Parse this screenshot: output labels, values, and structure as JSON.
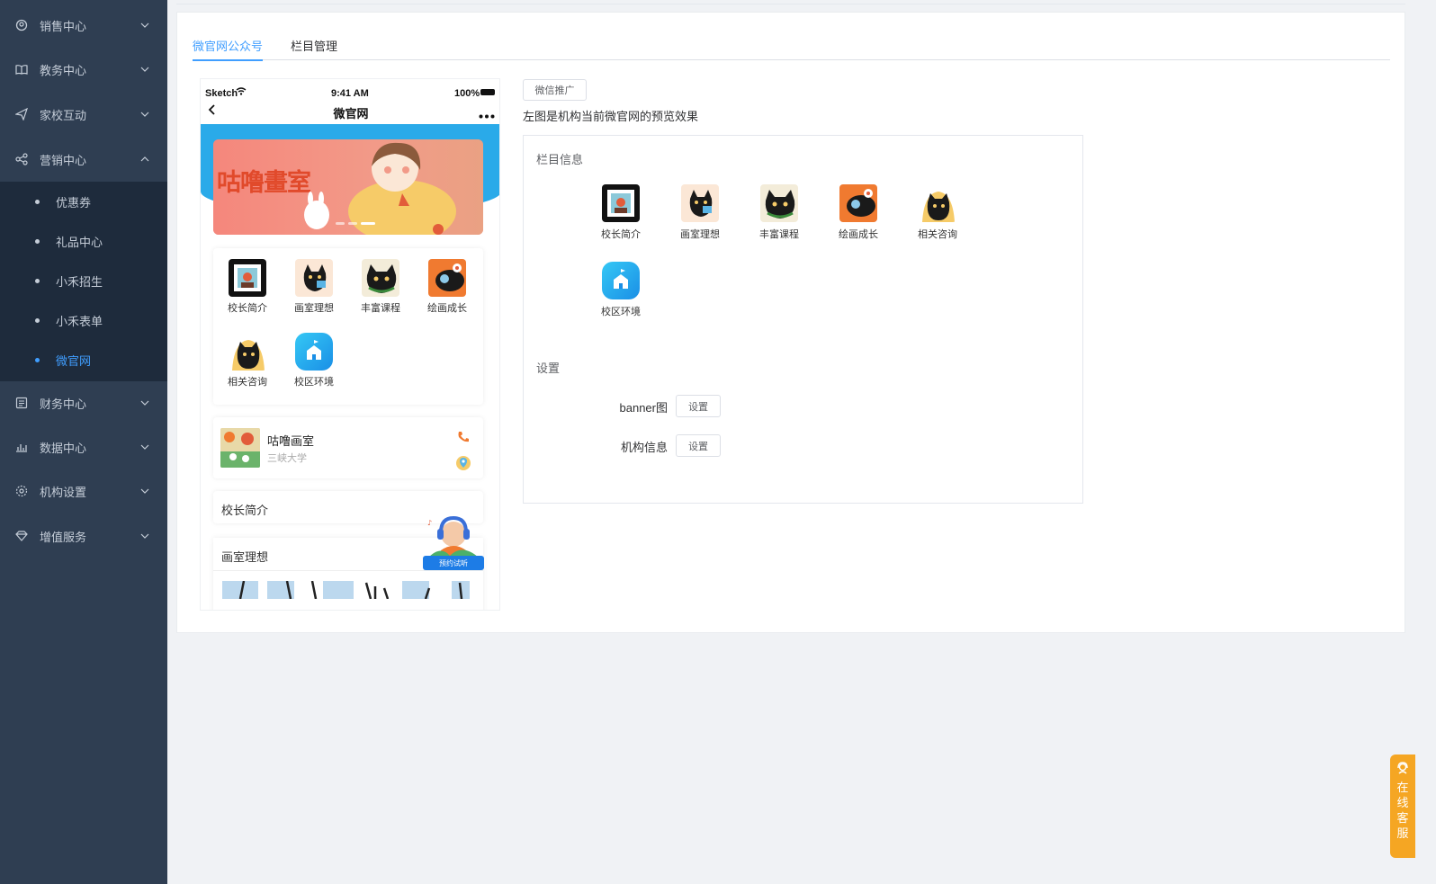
{
  "sidebar": {
    "menus": [
      {
        "label": "销售中心",
        "icon": "sales-icon"
      },
      {
        "label": "教务中心",
        "icon": "book-icon"
      },
      {
        "label": "家校互动",
        "icon": "send-icon"
      },
      {
        "label": "营销中心",
        "icon": "share-icon"
      },
      {
        "label": "财务中心",
        "icon": "finance-icon"
      },
      {
        "label": "数据中心",
        "icon": "chart-icon"
      },
      {
        "label": "机构设置",
        "icon": "gear-icon"
      },
      {
        "label": "增值服务",
        "icon": "diamond-icon"
      }
    ],
    "submenu": [
      {
        "label": "优惠券"
      },
      {
        "label": "礼品中心"
      },
      {
        "label": "小禾招生"
      },
      {
        "label": "小禾表单"
      },
      {
        "label": "微官网"
      }
    ]
  },
  "tabs": [
    {
      "label": "微官网公众号"
    },
    {
      "label": "栏目管理"
    }
  ],
  "phone": {
    "carrier": "Sketch",
    "time": "9:41 AM",
    "battery": "100%",
    "nav_title": "微官网",
    "banner_title": "咕噜畫室",
    "grid": [
      {
        "label": "校长简介"
      },
      {
        "label": "画室理想"
      },
      {
        "label": "丰富课程"
      },
      {
        "label": "绘画成长"
      },
      {
        "label": "相关咨询"
      },
      {
        "label": "校区环境"
      }
    ],
    "org_name": "咕噜画室",
    "org_address": "三峡大学",
    "section1": "校长简介",
    "section2": "画室理想",
    "float_label": "预约试听"
  },
  "right": {
    "promo_button": "微信推广",
    "hint": "左图是机构当前微官网的预览效果",
    "columns_header": "栏目信息",
    "columns": [
      {
        "label": "校长简介"
      },
      {
        "label": "画室理想"
      },
      {
        "label": "丰富课程"
      },
      {
        "label": "绘画成长"
      },
      {
        "label": "相关咨询"
      },
      {
        "label": "校区环境"
      }
    ],
    "settings_header": "设置",
    "banner_label": "banner图",
    "org_label": "机构信息",
    "set_button": "设置"
  },
  "service": [
    "在",
    "线",
    "客",
    "服"
  ],
  "colors": {
    "accent": "#409eff",
    "sidebar": "#2f3e52",
    "submenu": "#1e2b3c",
    "service": "#f5a623"
  }
}
